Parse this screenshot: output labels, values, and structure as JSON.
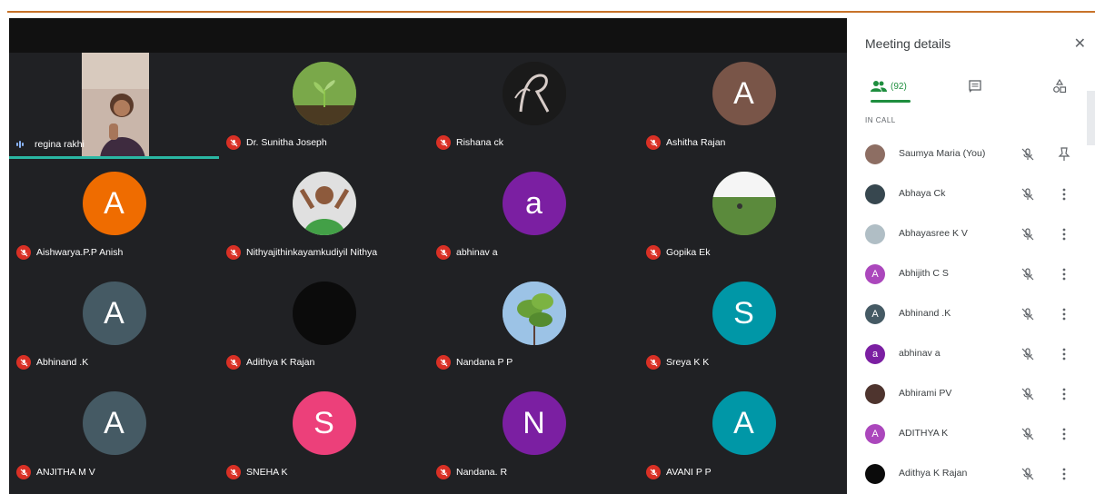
{
  "colors": {
    "accent_green": "#1e8e3e",
    "mute_red": "#d93025",
    "active_teal": "#2ab7a3"
  },
  "grid": {
    "tiles": [
      {
        "name": "regina rakhi",
        "avatar_letter": "",
        "avatar_color": "",
        "kind": "camera",
        "speaking": true
      },
      {
        "name": "Dr. Sunitha Joseph",
        "avatar_letter": "",
        "avatar_color": "#6a8f3a",
        "kind": "image-plant"
      },
      {
        "name": "Rishana ck",
        "avatar_letter": "",
        "avatar_color": "#1a1a1a",
        "kind": "image-logo"
      },
      {
        "name": "Ashitha Rajan",
        "avatar_letter": "A",
        "avatar_color": "#795548",
        "kind": "letter"
      },
      {
        "name": "Aishwarya.P.P Anish",
        "avatar_letter": "A",
        "avatar_color": "#ef6c00",
        "kind": "letter"
      },
      {
        "name": "Nithyajithinkayamkudiyil Nithya",
        "avatar_letter": "",
        "avatar_color": "#4a7c3a",
        "kind": "image-person"
      },
      {
        "name": "abhinav a",
        "avatar_letter": "a",
        "avatar_color": "#7b1fa2",
        "kind": "letter"
      },
      {
        "name": "Gopika Ek",
        "avatar_letter": "",
        "avatar_color": "#4f7a3a",
        "kind": "image-field"
      },
      {
        "name": "Abhinand .K",
        "avatar_letter": "A",
        "avatar_color": "#455a64",
        "kind": "letter"
      },
      {
        "name": "Adithya K Rajan",
        "avatar_letter": "",
        "avatar_color": "#0b0b0b",
        "kind": "letter"
      },
      {
        "name": "Nandana P P",
        "avatar_letter": "",
        "avatar_color": "#7fa6c9",
        "kind": "image-tree"
      },
      {
        "name": "Sreya K K",
        "avatar_letter": "S",
        "avatar_color": "#0097a7",
        "kind": "letter"
      },
      {
        "name": "ANJITHA M V",
        "avatar_letter": "A",
        "avatar_color": "#455a64",
        "kind": "letter"
      },
      {
        "name": "SNEHA K",
        "avatar_letter": "S",
        "avatar_color": "#ec407a",
        "kind": "letter"
      },
      {
        "name": "Nandana. R",
        "avatar_letter": "N",
        "avatar_color": "#7b1fa2",
        "kind": "letter"
      },
      {
        "name": "AVANI P P",
        "avatar_letter": "A",
        "avatar_color": "#0097a7",
        "kind": "letter"
      }
    ]
  },
  "panel": {
    "title": "Meeting details",
    "close_icon": "close-icon",
    "people_count": "(92)",
    "section_label": "IN CALL",
    "people": [
      {
        "name": "Saumya Maria (You)",
        "avatar_letter": "",
        "avatar_color": "#8d6e63",
        "action": "pin"
      },
      {
        "name": "Abhaya Ck",
        "avatar_letter": "",
        "avatar_color": "#37474f",
        "action": "more"
      },
      {
        "name": "Abhayasree K V",
        "avatar_letter": "",
        "avatar_color": "#b0bec5",
        "action": "more"
      },
      {
        "name": "Abhijith C S",
        "avatar_letter": "A",
        "avatar_color": "#ab47bc",
        "action": "more"
      },
      {
        "name": "Abhinand .K",
        "avatar_letter": "A",
        "avatar_color": "#455a64",
        "action": "more"
      },
      {
        "name": "abhinav a",
        "avatar_letter": "a",
        "avatar_color": "#7b1fa2",
        "action": "more"
      },
      {
        "name": "Abhirami PV",
        "avatar_letter": "",
        "avatar_color": "#4e342e",
        "action": "more"
      },
      {
        "name": "ADITHYA K",
        "avatar_letter": "A",
        "avatar_color": "#ab47bc",
        "action": "more"
      },
      {
        "name": "Adithya K Rajan",
        "avatar_letter": "",
        "avatar_color": "#0b0b0b",
        "action": "more"
      }
    ]
  }
}
